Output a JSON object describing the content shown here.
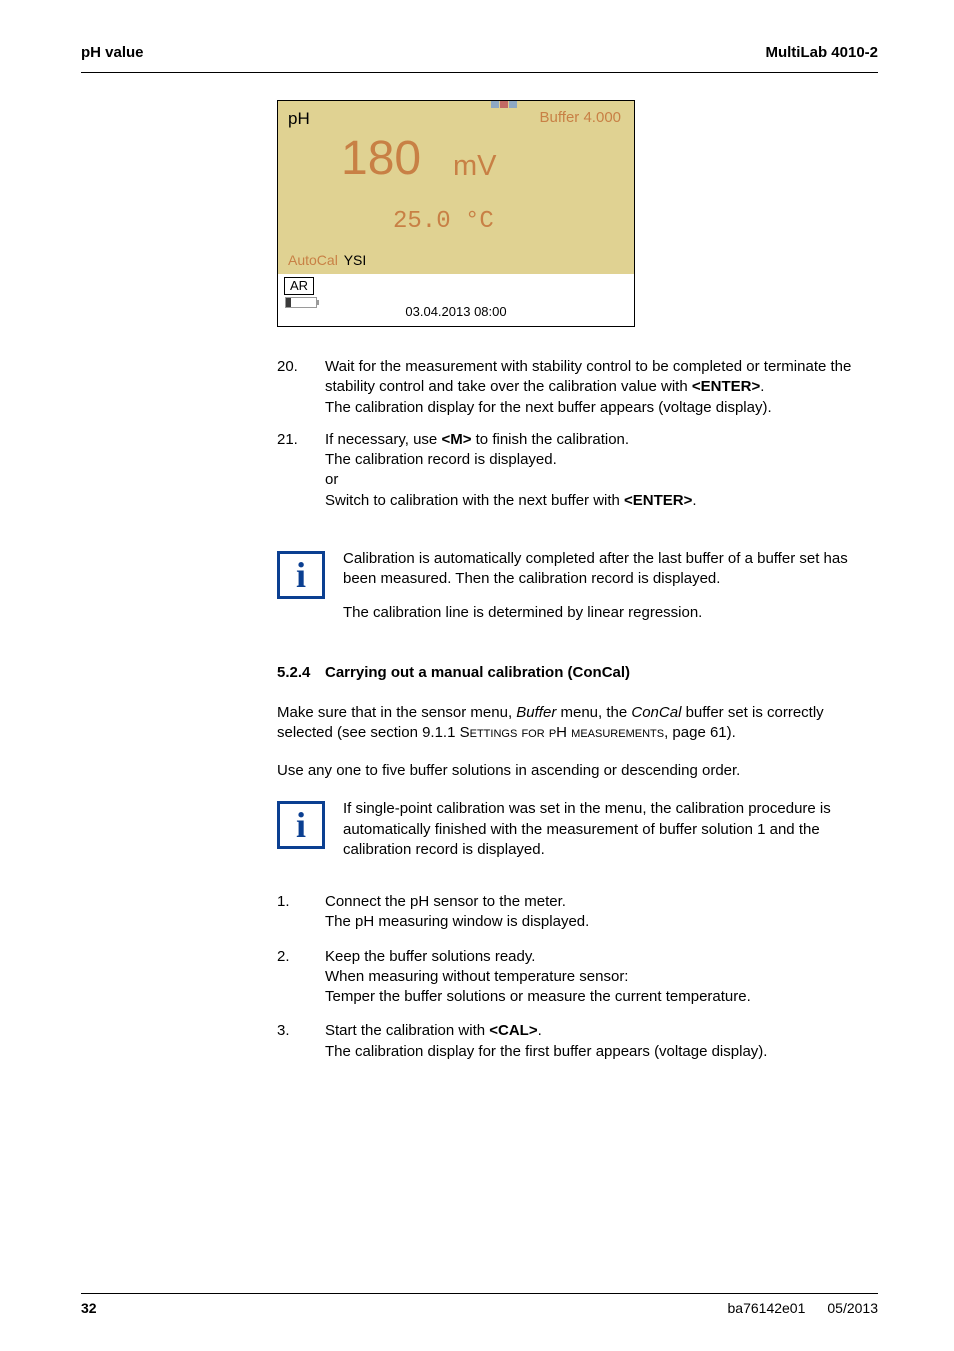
{
  "header": {
    "left": "pH value",
    "right": "MultiLab 4010-2"
  },
  "screen": {
    "ph_label": "pH",
    "buffer": "Buffer  4.000",
    "value": "180",
    "unit": "mV",
    "temp": "25.0 °C",
    "autocal": "AutoCal",
    "ysi": "YSI",
    "ar": "AR",
    "timestamp": "03.04.2013 08:00"
  },
  "steps": {
    "s20": {
      "num": "20.",
      "p1a": "Wait for the measurement with stability control to be completed or terminate the stability control and take over the calibration value with ",
      "key1": "<ENTER>",
      "p1b": ".",
      "p2": "The calibration display for the next buffer appears (voltage display)."
    },
    "s21": {
      "num": "21.",
      "l1a": "If necessary, use ",
      "key1": "<M>",
      "l1b": " to finish the calibration.",
      "l2": "The calibration record is displayed.",
      "l3": "or",
      "l4a": "Switch to calibration with the next buffer with ",
      "key2": "<ENTER>",
      "l4b": "."
    }
  },
  "info1": {
    "p1": "Calibration is automatically completed after the last buffer of a buffer set has been measured. Then the calibration record is displayed.",
    "p2": "The calibration line is determined by linear regression."
  },
  "section": {
    "num": "5.2.4",
    "title": "Carrying out a manual calibration (ConCal)"
  },
  "para1": {
    "a": "Make sure that in the sensor menu, ",
    "i1": "Buffer",
    "b": " menu, the ",
    "i2": "ConCal",
    "c": " buffer set is correctly selected (see section 9.1.1 ",
    "sc": "Settings for pH measurements",
    "d": ", page 61)."
  },
  "para2": "Use any one to five buffer solutions in ascending or descending order.",
  "info2": {
    "p1": "If single-point calibration was set in the menu, the calibration procedure is automatically finished with the measurement of buffer solution 1 and the calibration record is displayed."
  },
  "numlist": {
    "n1": {
      "num": "1.",
      "l1": "Connect the pH sensor to the meter.",
      "l2": "The pH measuring window is displayed."
    },
    "n2": {
      "num": "2.",
      "l1": "Keep the buffer solutions ready.",
      "l2": "When measuring without temperature sensor:",
      "l3": "Temper the buffer solutions or measure the current temperature."
    },
    "n3": {
      "num": "3.",
      "l1a": "Start the calibration with ",
      "key": "<CAL>",
      "l1b": ".",
      "l2": "The calibration display for the first buffer appears (voltage display)."
    }
  },
  "footer": {
    "page": "32",
    "doc": "ba76142e01",
    "date": "05/2013"
  }
}
